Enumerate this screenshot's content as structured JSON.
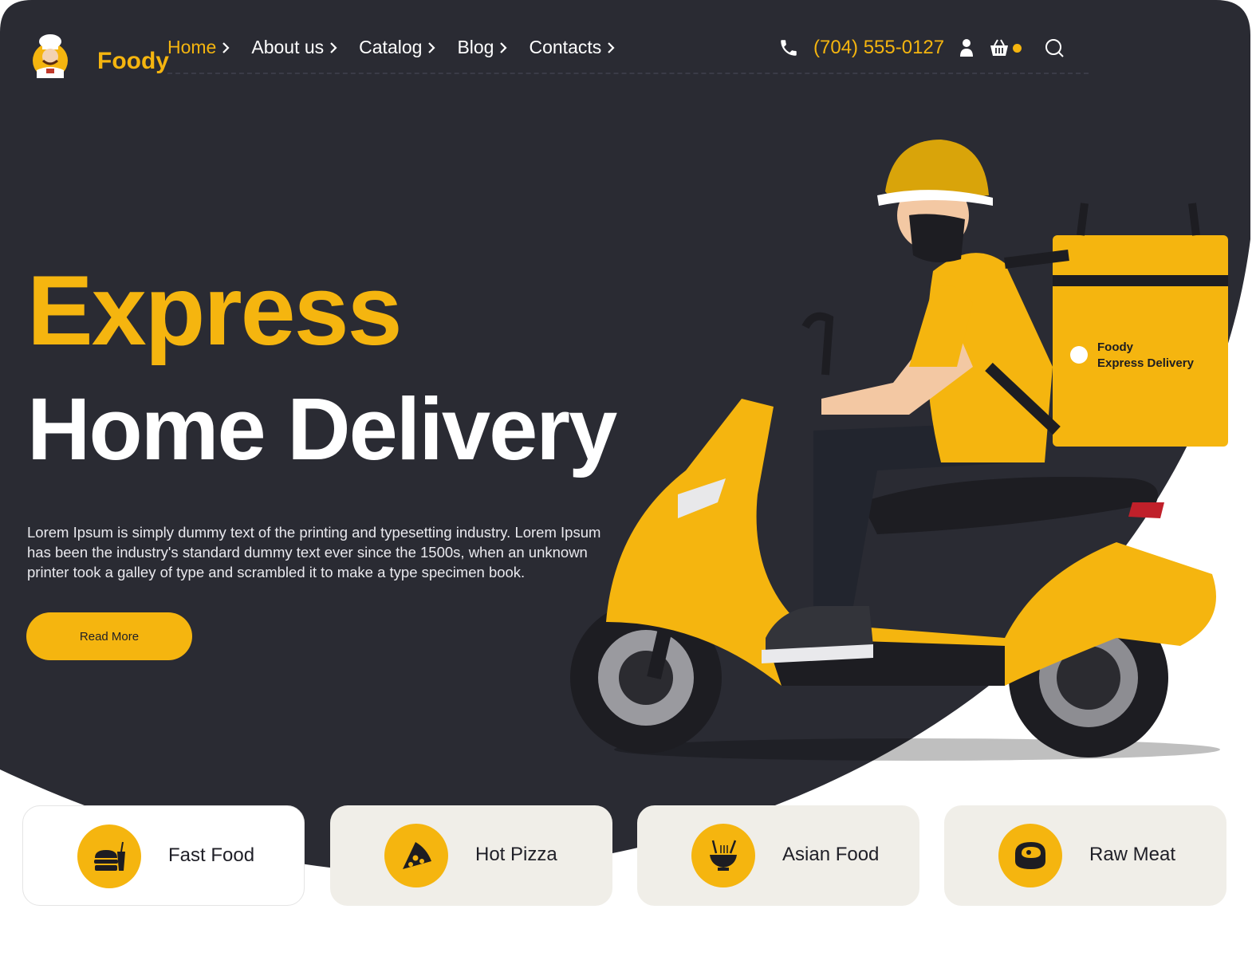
{
  "brand": {
    "name": "Foody",
    "logo_icon": "chef-logo-icon"
  },
  "nav": {
    "items": [
      {
        "label": "Home",
        "active": true
      },
      {
        "label": "About us",
        "active": false
      },
      {
        "label": "Catalog",
        "active": false
      },
      {
        "label": "Blog",
        "active": false
      },
      {
        "label": "Contacts",
        "active": false
      }
    ]
  },
  "contact": {
    "phone": "(704) 555-0127",
    "icons": [
      "phone-icon",
      "user-icon",
      "cart-icon",
      "search-icon"
    ]
  },
  "hero": {
    "title_line1": "Express",
    "title_line2": "Home Delivery",
    "description": "Lorem Ipsum is simply dummy text of the printing and typesetting industry. Lorem Ipsum has been the industry's standard dummy text ever since the 1500s, when an unknown printer took a galley of type and scrambled it to make a type specimen book.",
    "button_label": "Read More",
    "bag_text_line1": "Foody",
    "bag_text_line2": "Express Delivery"
  },
  "categories": [
    {
      "label": "Fast Food",
      "icon": "burger-soda-icon"
    },
    {
      "label": "Hot Pizza",
      "icon": "pizza-icon"
    },
    {
      "label": "Asian Food",
      "icon": "noodle-bowl-icon"
    },
    {
      "label": "Raw Meat",
      "icon": "steak-icon"
    }
  ],
  "colors": {
    "accent": "#f5b50f",
    "dark": "#2a2b33",
    "card_bg": "#f0eee8"
  }
}
